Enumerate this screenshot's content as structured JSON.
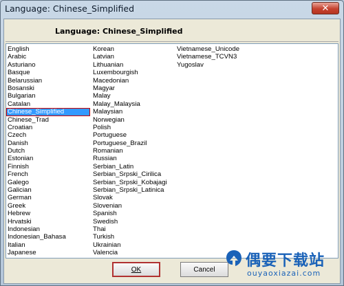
{
  "window": {
    "title": "Language: Chinese_Simplified",
    "close_glyph": "✕"
  },
  "header": {
    "label": "Language: Chinese_Simplified"
  },
  "languages": {
    "selected": "Chinese_Simplified",
    "column1": [
      "English",
      "Arabic",
      "Asturiano",
      "Basque",
      "Belarussian",
      "Bosanski",
      "Bulgarian",
      "Catalan",
      "Chinese_Simplified",
      "Chinese_Trad",
      "Croatian",
      "Czech",
      "Danish",
      "Dutch",
      "Estonian",
      "Finnish",
      "French",
      "Galego",
      "Galician",
      "German",
      "Greek",
      "Hebrew",
      "Hrvatski",
      "Indonesian",
      "Indonesian_Bahasa",
      "Italian",
      "Japanese"
    ],
    "column2": [
      "Korean",
      "Latvian",
      "Lithuanian",
      "Luxembourgish",
      "Macedonian",
      "Magyar",
      "Malay",
      "Malay_Malaysia",
      "Malaysian",
      "Norwegian",
      "Polish",
      "Portuguese",
      "Portuguese_Brazil",
      "Romanian",
      "Russian",
      "Serbian_Latin",
      "Serbian_Srpski_Cirilica",
      "Serbian_Srpski_Kobajagi",
      "Serbian_Srpski_Latinica",
      "Slovak",
      "Slovenian",
      "Spanish",
      "Swedish",
      "Thai",
      "Turkish",
      "Ukrainian",
      "Valencia"
    ],
    "column3": [
      "Vietnamese_Unicode",
      "Vietnamese_TCVN3",
      "Yugoslav"
    ]
  },
  "buttons": {
    "ok_label": "OK",
    "cancel_label": "Cancel"
  },
  "watermark": {
    "title": "偶要下载站",
    "url": "ouyaoxiazai.com"
  },
  "colors": {
    "selection": "#3399ff",
    "accent": "#1a62b8"
  }
}
